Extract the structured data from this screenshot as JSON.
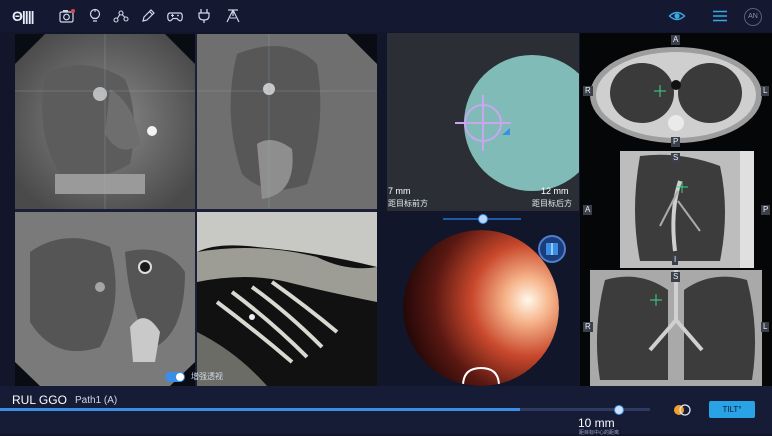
{
  "app": {
    "logo": "Θ||||"
  },
  "toolbar": {
    "icons": [
      "camera-icon",
      "lightbulb-icon",
      "nodes-icon",
      "pen-icon",
      "gamepad-icon",
      "plug-icon",
      "tripod-icon"
    ],
    "right_icons": [
      "eye-icon",
      "menu-icon"
    ],
    "avatar": "AN"
  },
  "ct_panel": {
    "toggle_label": "增强透视",
    "toggle_on": true
  },
  "virtual_view": {
    "left_distance": "7 mm",
    "left_caption": "距目标前方",
    "right_distance": "12 mm",
    "right_caption": "距目标后方",
    "slider_position": 0.52
  },
  "endoscope": {
    "button_icon": "book-icon"
  },
  "views": {
    "axial": {
      "top": "A",
      "left": "R",
      "right": "L",
      "bottom": "P"
    },
    "sagittal": {
      "top": "S",
      "left": "A",
      "right": "P",
      "bottom": "I"
    },
    "coronal": {
      "top": "S",
      "left": "R",
      "right": "L"
    }
  },
  "path": {
    "name": "RUL GGO",
    "sub": "Path1 (A)",
    "progress": 0.8,
    "distance": "10 mm",
    "distance_caption": "距目标中心的距离",
    "tilt_button": "TILT°"
  },
  "colors": {
    "accent": "#3a8ee6",
    "target": "#8fd4cf",
    "crosshair": "#c9a6f0"
  }
}
